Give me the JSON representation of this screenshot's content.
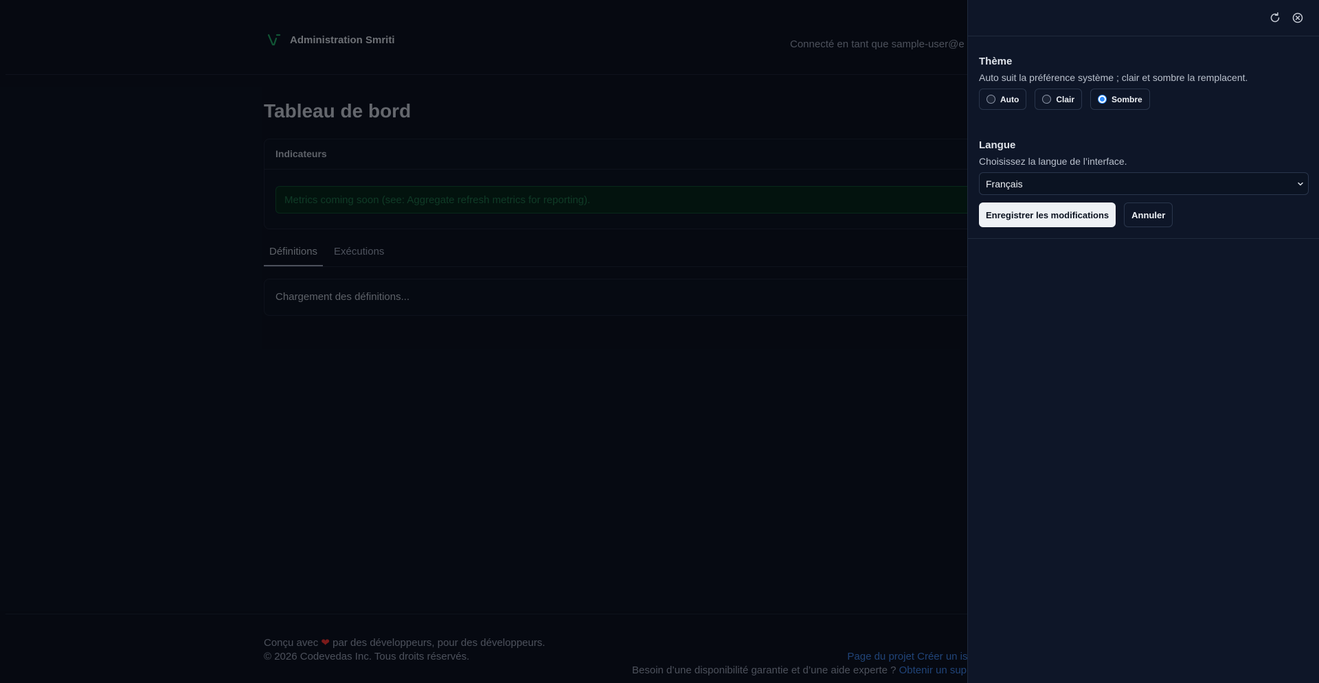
{
  "header": {
    "app_name": "Administration Smriti",
    "user_label": "Connecté en tant que sample-user@e"
  },
  "main": {
    "title": "Tableau de bord",
    "indicators": {
      "title": "Indicateurs",
      "alert": "Metrics coming soon (see: Aggregate refresh metrics for reporting)."
    },
    "tabs": [
      {
        "label": "Définitions",
        "active": true
      },
      {
        "label": "Exécutions",
        "active": false
      }
    ],
    "loading_text": "Chargement des définitions..."
  },
  "footer": {
    "made_with_prefix": "Conçu avec",
    "made_with_suffix": "par des développeurs, pour des développeurs.",
    "copyright": "© 2026 Codevedas Inc. Tous droits réservés.",
    "project_link": "Page du projet",
    "issue_link": "Créer un iss",
    "support_prefix": "Besoin d’une disponibilité garantie et d’une aide experte ?",
    "support_link": "Obtenir un suppo"
  },
  "drawer": {
    "theme": {
      "title": "Thème",
      "description": "Auto suit la préférence système ; clair et sombre la remplacent.",
      "options": [
        {
          "label": "Auto",
          "checked": false
        },
        {
          "label": "Clair",
          "checked": false
        },
        {
          "label": "Sombre",
          "checked": true
        }
      ]
    },
    "language": {
      "title": "Langue",
      "description": "Choisissez la langue de l’interface.",
      "selected": "Français"
    },
    "save_label": "Enregistrer les modifications",
    "cancel_label": "Annuler"
  },
  "colors": {
    "accent": "#2d8cff",
    "brand_green": "#22c55e",
    "heart": "#e03131",
    "link": "#3b7ad9"
  },
  "icons": {
    "refresh": "refresh-icon",
    "close": "close-icon",
    "logo": "logo-icon",
    "heart": "heart-icon",
    "chevron": "chevron-down-icon"
  }
}
